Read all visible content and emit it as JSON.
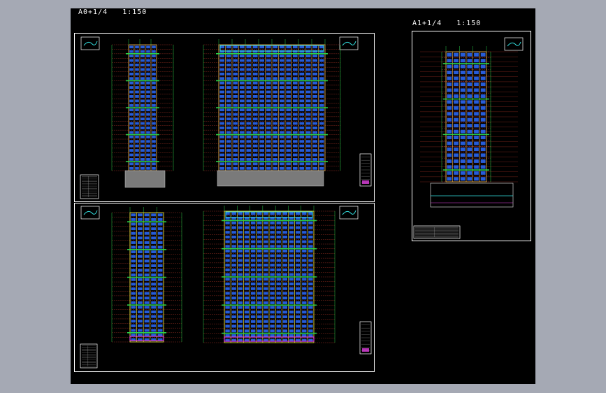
{
  "viewport": {
    "background_color": "#a5a9b4",
    "canvas_color": "#000000"
  },
  "layouts": {
    "a0": {
      "label": "A0+1/4",
      "scale": "1:150"
    },
    "a1": {
      "label": "A1+1/4",
      "scale": "1:150"
    }
  },
  "drawings": {
    "elevation_1": {
      "type": "side-elevation",
      "color_scheme": "orange-blue"
    },
    "elevation_2": {
      "type": "front-elevation",
      "color_scheme": "orange-blue"
    },
    "elevation_3": {
      "type": "side-elevation",
      "color_scheme": "yellow-blue"
    },
    "elevation_4": {
      "type": "front-elevation",
      "color_scheme": "yellow-blue"
    },
    "section_1": {
      "type": "building-section"
    }
  },
  "colors": {
    "sheet_border": "#ffffff",
    "floor_lines": "#c0392b",
    "window_blue": "#2d6cff",
    "frame_orange": "#d9a44a",
    "frame_yellow": "#e6dd3a",
    "dim_green": "#29d14a",
    "podium_gray": "#7a7a7a",
    "magenta": "#e040e0",
    "cyan": "#33e0e0"
  }
}
